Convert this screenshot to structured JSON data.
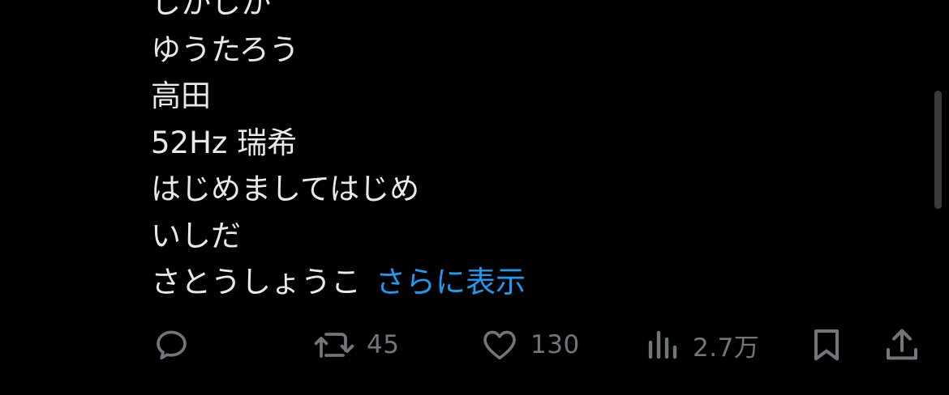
{
  "post": {
    "lines": [
      "しかしか",
      "ゆうたろう",
      "高田",
      "52Hz 瑞希",
      "はじめましてはじめ",
      "いしだ",
      "さとうしょうこ"
    ],
    "show_more_label": "さらに表示"
  },
  "actions": {
    "reply": {
      "icon": "reply-icon"
    },
    "repost": {
      "icon": "repost-icon",
      "count": "45"
    },
    "like": {
      "icon": "heart-icon",
      "count": "130"
    },
    "views": {
      "icon": "views-icon",
      "count": "2.7万"
    },
    "bookmark": {
      "icon": "bookmark-icon"
    },
    "share": {
      "icon": "share-icon"
    }
  },
  "colors": {
    "background": "#000000",
    "text": "#e7e9ea",
    "link": "#1d9bf0",
    "icon": "#71767b"
  }
}
